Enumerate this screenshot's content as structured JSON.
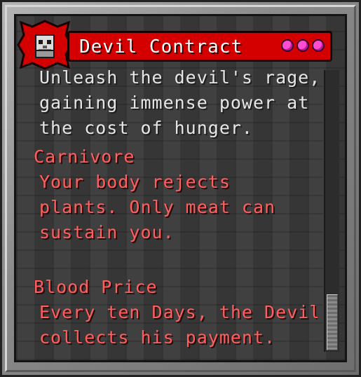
{
  "window": {
    "title": "Devil Contract",
    "emblem_icon": "skull-icon",
    "indicator_dots": 3,
    "colors": {
      "banner": "#d40000",
      "dot": "#ff4fd0",
      "trait_text": "#ff5f5f",
      "body_text": "#e6e6e6"
    }
  },
  "description": [
    "Unleash the devil's rage,",
    "gaining immense power at",
    "the cost of hunger."
  ],
  "traits": [
    {
      "name": "Carnivore",
      "lines": [
        "Your body rejects",
        "plants. Only meat can",
        "sustain you."
      ]
    },
    {
      "name": "Blood Price",
      "lines": [
        "Every ten Days, the Devil",
        "collects his payment."
      ]
    }
  ]
}
